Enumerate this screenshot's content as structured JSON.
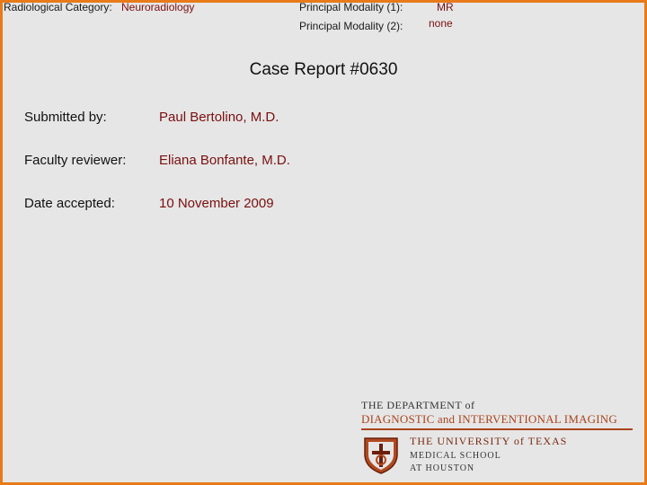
{
  "header": {
    "category_label": "Radiological Category:",
    "category_value": "Neuroradiology",
    "modality1_label": "Principal Modality (1):",
    "modality1_value": "MR",
    "modality2_label": "Principal Modality (2):",
    "modality2_value": "none"
  },
  "title": "Case Report #0630",
  "details": [
    {
      "label": "Submitted by:",
      "value": "Paul Bertolino, M.D."
    },
    {
      "label": "Faculty reviewer:",
      "value": "Eliana Bonfante, M.D."
    },
    {
      "label": "Date accepted:",
      "value": "10 November 2009"
    }
  ],
  "logo": {
    "line1": "THE DEPARTMENT of",
    "line2": "DIAGNOSTIC and INTERVENTIONAL IMAGING",
    "university": "THE UNIVERSITY of TEXAS",
    "school_line1": "MEDICAL SCHOOL",
    "school_line2": "AT HOUSTON"
  },
  "colors": {
    "border": "#e87a1a",
    "accent": "#7a0f0f",
    "background": "#e6e6e6"
  }
}
